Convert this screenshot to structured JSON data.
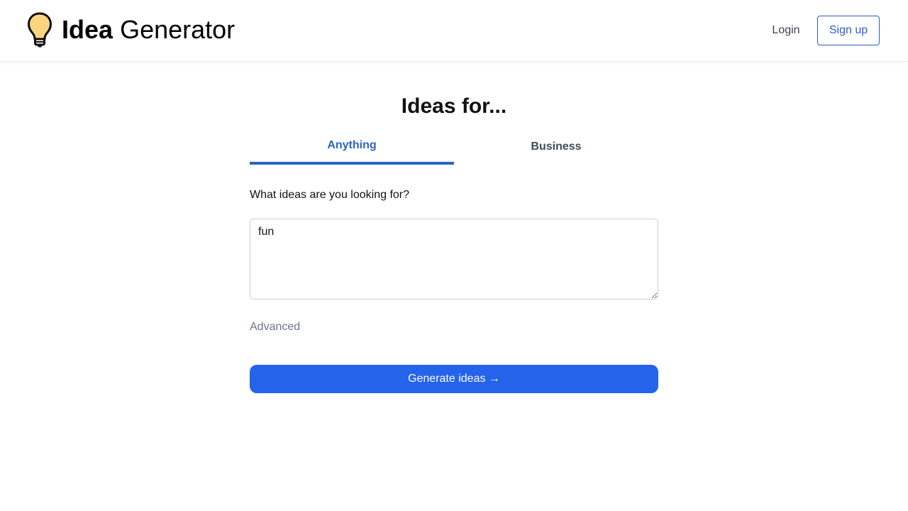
{
  "header": {
    "logo_bold": "Idea",
    "logo_regular": "Generator",
    "logo_icon": "lightbulb-icon",
    "login_label": "Login",
    "signup_label": "Sign up"
  },
  "main": {
    "title": "Ideas for...",
    "tabs": [
      {
        "label": "Anything",
        "active": true
      },
      {
        "label": "Business",
        "active": false
      }
    ],
    "prompt_label": "What ideas are you looking for?",
    "input_value": "fun",
    "advanced_label": "Advanced",
    "generate_label": "Generate ideas →"
  },
  "colors": {
    "accent": "#2563eb",
    "tab_active": "#2b64c8",
    "bulb_fill": "#fcd581"
  }
}
